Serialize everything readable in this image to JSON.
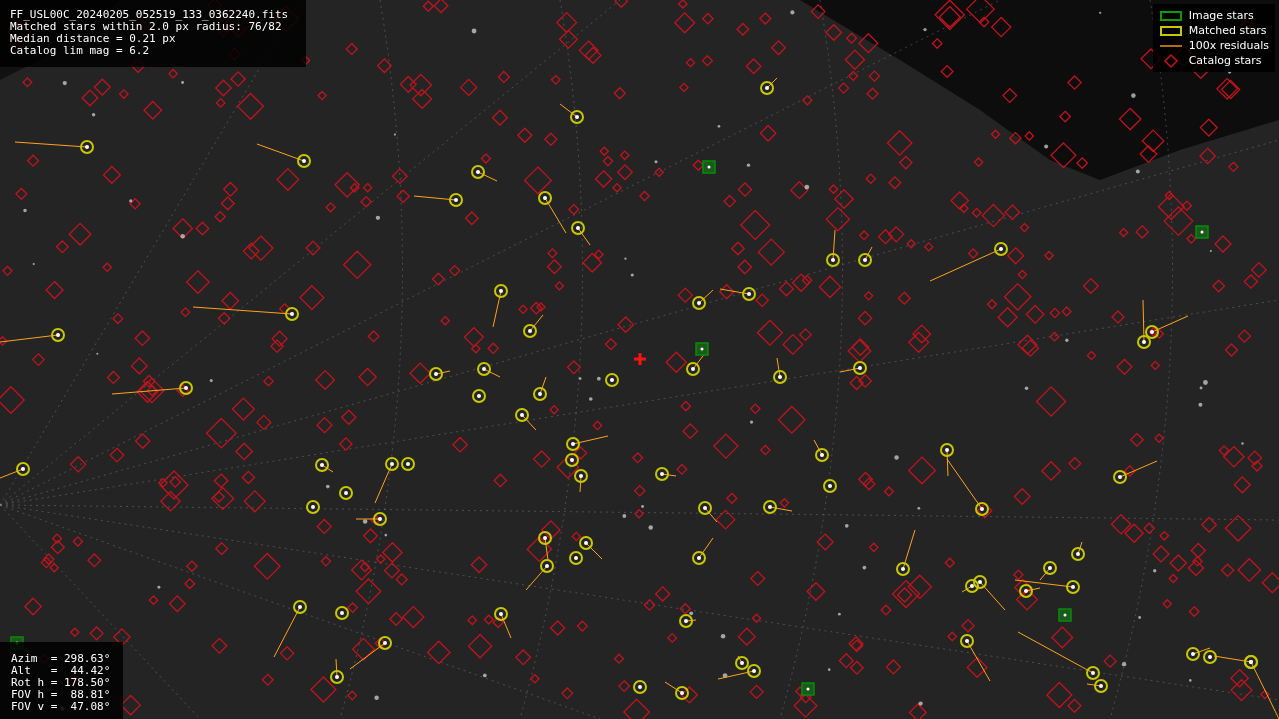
{
  "info_top": [
    "FF_USL00C_20240205_052519_133_0362240.fits",
    "Matched stars within 2.0 px radius: 76/82",
    "Median distance = 0.21 px",
    "Catalog lim mag = 6.2"
  ],
  "legend": [
    {
      "kind": "image",
      "label": "Image stars"
    },
    {
      "kind": "matched",
      "label": "Matched stars"
    },
    {
      "kind": "residual",
      "label": "100x residuals"
    },
    {
      "kind": "catalog",
      "label": "Catalog stars"
    }
  ],
  "pointing": [
    "Azim  = 298.63°",
    "Alt   =  44.42°",
    "Rot h = 178.50°",
    "FOV h =  88.81°",
    "FOV v =  47.08°"
  ]
}
